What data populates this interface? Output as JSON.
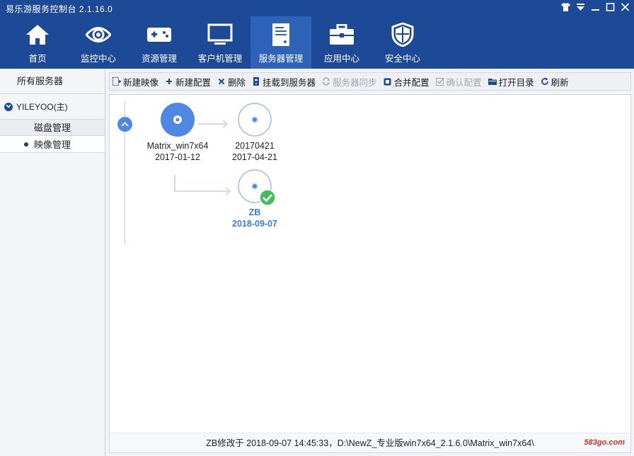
{
  "app": {
    "title": "易乐游服务控制台 2.1.16.0"
  },
  "window_controls": [
    "shirt-icon",
    "dropdown-icon",
    "minimize-icon",
    "maximize-icon",
    "close-icon"
  ],
  "nav": {
    "items": [
      {
        "label": "首页",
        "icon": "home-icon"
      },
      {
        "label": "监控中心",
        "icon": "eye-icon"
      },
      {
        "label": "资源管理",
        "icon": "gamepad-icon"
      },
      {
        "label": "客户机管理",
        "icon": "monitor-icon"
      },
      {
        "label": "服务器管理",
        "icon": "server-icon",
        "active": true
      },
      {
        "label": "应用中心",
        "icon": "toolbox-icon"
      },
      {
        "label": "安全中心",
        "icon": "shield-icon"
      }
    ]
  },
  "sidebar": {
    "header": "所有服务器",
    "server": "YILEYOO(主)",
    "group": "磁盘管理",
    "item": "映像管理"
  },
  "toolbar": {
    "buttons": [
      {
        "label": "新建映像",
        "icon": "new-image-icon",
        "enabled": true
      },
      {
        "label": "新建配置",
        "icon": "plus-icon",
        "enabled": true
      },
      {
        "label": "删除",
        "icon": "delete-icon",
        "enabled": true
      },
      {
        "label": "挂载到服务器",
        "icon": "mount-icon",
        "enabled": true
      },
      {
        "label": "服务器同步",
        "icon": "sync-icon",
        "enabled": false
      },
      {
        "label": "合并配置",
        "icon": "merge-icon",
        "enabled": true
      },
      {
        "label": "确认配置",
        "icon": "confirm-icon",
        "enabled": false
      },
      {
        "label": "打开目录",
        "icon": "folder-icon",
        "enabled": true
      },
      {
        "label": "刷新",
        "icon": "refresh-icon",
        "enabled": true
      }
    ]
  },
  "tree": {
    "root": {
      "name": "Matrix_win7x64",
      "date": "2017-01-12"
    },
    "children": [
      {
        "name": "20170421",
        "date": "2017-04-21"
      },
      {
        "name": "ZB",
        "date": "2018-09-07",
        "current": true
      }
    ]
  },
  "status": {
    "text": "ZB修改于 2018-09-07 14:45:33，D:\\NewZ_专业版win7x64_2.1.6.0\\Matrix_win7x64\\"
  },
  "watermark": "583go.com",
  "colors": {
    "nav_bg": "#1c4a97",
    "nav_active": "#2e63b9",
    "accent": "#4f87e5",
    "check": "#3fbf5a"
  }
}
